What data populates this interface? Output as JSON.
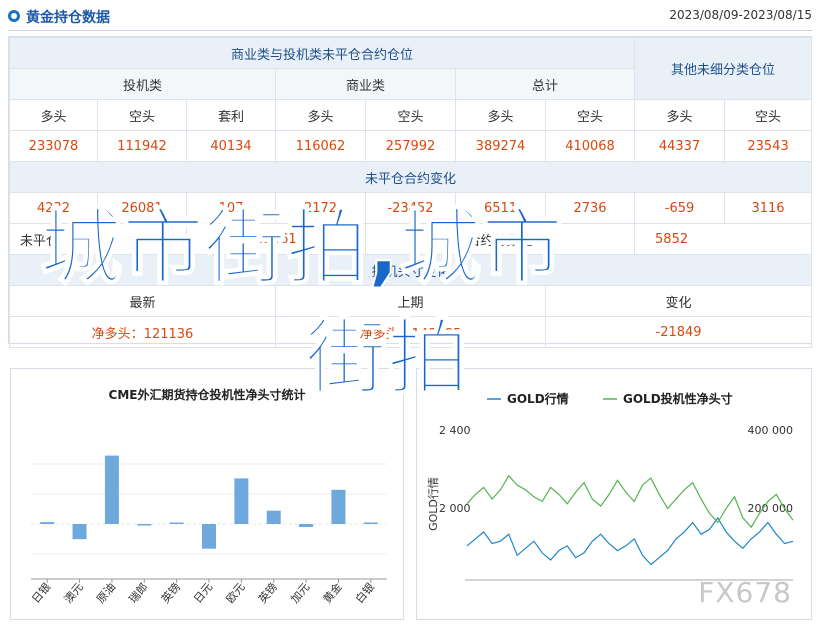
{
  "header": {
    "title": "黄金持仓数据",
    "date_range": "2023/08/09-2023/08/15"
  },
  "table": {
    "group_title": "商业类与投机类未平仓合约仓位",
    "right_title": "其他未细分类仓位",
    "sub_groups": [
      "投机类",
      "商业类",
      "总计"
    ],
    "columns": [
      "多头",
      "空头",
      "套利",
      "多头",
      "空头",
      "多头",
      "空头",
      "多头",
      "空头"
    ],
    "positions": [
      "233078",
      "111942",
      "40134",
      "116062",
      "257992",
      "389274",
      "410068",
      "44337",
      "23543"
    ],
    "change_title": "未平仓合约变化",
    "changes": [
      "4232",
      "26081",
      "107",
      "2172",
      "-23452",
      "6511",
      "2736",
      "-659",
      "3116"
    ],
    "row3_left": "未平仓",
    "row3_num1": "43461",
    "row3_mid": "合约总数量",
    "row3_num2": "5852",
    "row4_title": "投机头寸变化",
    "row5": [
      "最新",
      "上期",
      "变化"
    ],
    "row6": [
      "净多头：121136",
      "净多头：143985",
      "-21849"
    ]
  },
  "overlay": {
    "line1": "城市街拍,城市",
    "line2": "街拍"
  },
  "chart_data": [
    {
      "type": "bar",
      "title": "CME外汇期货持仓投机性净头寸统计",
      "categories": [
        "日银",
        "澳元",
        "原油",
        "瑞郎",
        "英镑",
        "日元",
        "欧元",
        "英镑",
        "加元",
        "黄金",
        "白银"
      ],
      "values": [
        0.5,
        -4,
        18,
        -0.3,
        0.3,
        -6.5,
        12,
        3.5,
        -0.8,
        9,
        0
      ],
      "grid": true
    },
    {
      "type": "line",
      "legend": [
        "GOLD行情",
        "GOLD投机性净头寸"
      ],
      "left_axis_label": "GOLD行情",
      "left_ticks": [
        "2 400",
        "2 000"
      ],
      "right_ticks": [
        "400 000",
        "200 000"
      ],
      "series": [
        {
          "name": "GOLD行情",
          "color": "#1f86c8",
          "values": [
            1960,
            1975,
            1990,
            1965,
            1970,
            1985,
            1940,
            1955,
            1970,
            1945,
            1930,
            1950,
            1960,
            1935,
            1945,
            1970,
            1985,
            1965,
            1950,
            1960,
            1975,
            1940,
            1920,
            1935,
            1950,
            1975,
            1990,
            2010,
            1985,
            1995,
            2020,
            1990,
            1970,
            1955,
            1975,
            1990,
            2010,
            1985,
            1965,
            1970
          ]
        },
        {
          "name": "GOLD投机性净头寸",
          "color": "#53b34f",
          "values": [
            2050,
            2070,
            2085,
            2060,
            2080,
            2110,
            2090,
            2080,
            2065,
            2055,
            2085,
            2070,
            2050,
            2075,
            2095,
            2060,
            2045,
            2070,
            2100,
            2075,
            2055,
            2090,
            2105,
            2070,
            2040,
            2060,
            2080,
            2095,
            2060,
            2030,
            2010,
            2040,
            2065,
            2020,
            2000,
            2030,
            2055,
            2070,
            2040,
            2015
          ]
        }
      ]
    }
  ],
  "watermark": "FX678"
}
